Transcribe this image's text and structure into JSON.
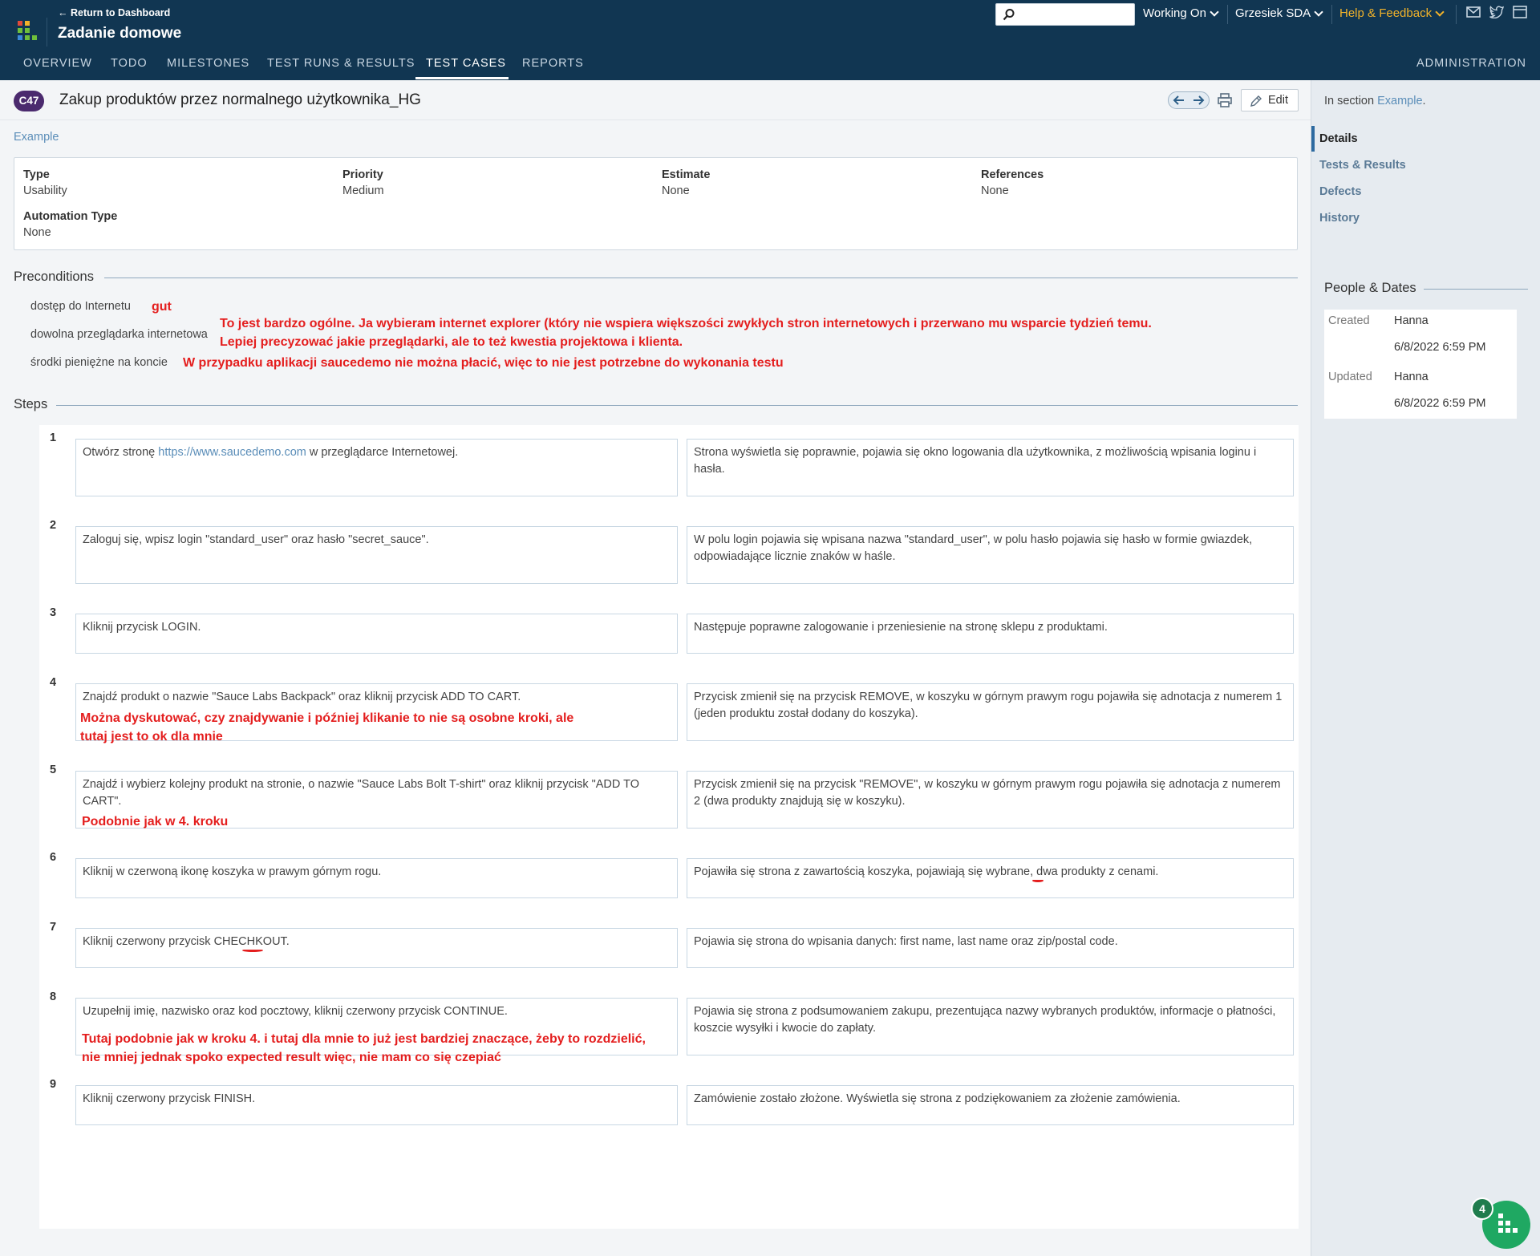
{
  "header": {
    "back_link": "← Return to Dashboard",
    "project_title": "Zadanie domowe",
    "search_placeholder": "",
    "working_on": "Working On",
    "user": "Grzesiek SDA",
    "help": "Help & Feedback"
  },
  "tabs": [
    {
      "label": "OVERVIEW"
    },
    {
      "label": "TODO"
    },
    {
      "label": "MILESTONES"
    },
    {
      "label": "TEST RUNS & RESULTS"
    },
    {
      "label": "TEST CASES"
    },
    {
      "label": "REPORTS"
    }
  ],
  "admin_tab": "ADMINISTRATION",
  "case": {
    "id": "C47",
    "title": "Zakup produktów przez normalnego użytkownika_HG",
    "edit_label": "Edit",
    "section": "Example"
  },
  "fields": {
    "type_label": "Type",
    "type_value": "Usability",
    "priority_label": "Priority",
    "priority_value": "Medium",
    "estimate_label": "Estimate",
    "estimate_value": "None",
    "references_label": "References",
    "references_value": "None",
    "automation_label": "Automation Type",
    "automation_value": "None"
  },
  "preconditions": {
    "heading": "Preconditions",
    "items": [
      "dostęp do Internetu",
      "dowolna przeglądarka internetowa",
      "środki pieniężne na koncie"
    ]
  },
  "notes": {
    "gut": "gut",
    "browser_1": "To jest bardzo ogólne. Ja wybieram internet explorer (który nie wspiera większości zwykłych stron internetowych i przerwano mu wsparcie tydzień temu.",
    "browser_2": "Lepiej precyzować jakie przeglądarki, ale to też kwestia projektowa i klienta.",
    "money": "W przypadku aplikacji saucedemo nie można płacić, więc to nie jest potrzebne do wykonania testu",
    "step4_1": "Można dyskutować, czy znajdywanie i później klikanie to nie są osobne kroki, ale",
    "step4_2": "tutaj jest to ok dla mnie",
    "step5": "Podobnie jak w 4. kroku",
    "step8_1": "Tutaj podobnie jak w kroku 4. i tutaj dla mnie to już jest bardziej znaczące, żeby to rozdzielić,",
    "step8_2": "nie mniej jednak spoko expected result więc, nie mam co się czepiać"
  },
  "steps_heading": "Steps",
  "steps": [
    {
      "no": "1",
      "action_pre": "Otwórz stronę ",
      "action_link": "https://www.saucedemo.com",
      "action_post": " w przeglądarce Internetowej.",
      "expected": "Strona wyświetla się poprawnie, pojawia się okno logowania dla użytkownika, z możliwością wpisania loginu i hasła."
    },
    {
      "no": "2",
      "action": "Zaloguj się, wpisz login \"standard_user\" oraz hasło \"secret_sauce\".",
      "expected": "W polu login pojawia się wpisana nazwa \"standard_user\", w polu hasło pojawia się hasło w formie gwiazdek, odpowiadające licznie znaków w haśle."
    },
    {
      "no": "3",
      "action": "Kliknij przycisk LOGIN.",
      "expected": "Następuje poprawne zalogowanie i przeniesienie na stronę sklepu z produktami."
    },
    {
      "no": "4",
      "action": "Znajdź produkt o nazwie \"Sauce Labs Backpack\" oraz kliknij przycisk ADD TO CART.",
      "expected": "Przycisk zmienił się na przycisk REMOVE, w koszyku w górnym prawym rogu pojawiła się adnotacja z numerem 1 (jeden produktu został dodany do koszyka)."
    },
    {
      "no": "5",
      "action": "Znajdź i wybierz kolejny produkt na stronie, o nazwie \"Sauce Labs Bolt T-shirt\" oraz kliknij przycisk \"ADD TO CART\".",
      "expected": "Przycisk zmienił się na przycisk \"REMOVE\", w koszyku w górnym prawym rogu pojawiła się adnotacja z numerem 2 (dwa produkty znajdują się w koszyku)."
    },
    {
      "no": "6",
      "action": "Kliknij w czerwoną ikonę koszyka w prawym górnym rogu.",
      "expected": "Pojawiła się strona z zawartością koszyka, pojawiają się wybrane, dwa produkty z cenami."
    },
    {
      "no": "7",
      "action": "Kliknij czerwony przycisk CHECHKOUT.",
      "expected": "Pojawia się strona do wpisania danych: first name, last name oraz zip/postal code."
    },
    {
      "no": "8",
      "action": "Uzupełnij imię, nazwisko oraz kod pocztowy, kliknij czerwony przycisk CONTINUE.",
      "expected": "Pojawia się strona z podsumowaniem zakupu, prezentująca nazwy wybranych produktów, informacje o płatności, koszcie wysyłki i kwocie do zapłaty."
    },
    {
      "no": "9",
      "action": "Kliknij czerwony przycisk FINISH.",
      "expected": "Zamówienie zostało złożone. Wyświetla się strona z podziękowaniem za złożenie zamówienia."
    }
  ],
  "sidebar": {
    "in_section_prefix": "In section ",
    "in_section_link": "Example",
    "in_section_suffix": ".",
    "nav": [
      "Details",
      "Tests & Results",
      "Defects",
      "History"
    ],
    "people_dates_heading": "People & Dates",
    "created_label": "Created",
    "created_by": "Hanna",
    "created_date": "6/8/2022 6:59 PM",
    "updated_label": "Updated",
    "updated_by": "Hanna",
    "updated_date": "6/8/2022 6:59 PM"
  },
  "fab_badge": "4",
  "colors": {
    "header": "#113652",
    "accent_link": "#5a8db8",
    "note_red": "#e41e1e",
    "badge_purple": "#4b2a6e",
    "help_yellow": "#f2b32a"
  }
}
